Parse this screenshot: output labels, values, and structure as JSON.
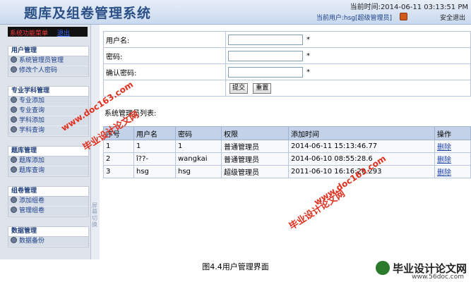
{
  "header": {
    "title": "题库及组卷管理系统",
    "time": "当前时间:2014-06-11 03:13:51 PM",
    "user": "当前用户:hsg[超级管理员]",
    "logout": "安全退出"
  },
  "sidebar": {
    "menu_label": "系统功能菜单",
    "menu_exit": "退出",
    "groups": [
      {
        "title": "用户管理",
        "items": [
          "系统管理员管理",
          "修改个人密码"
        ]
      },
      {
        "title": "专业学科管理",
        "items": [
          "专业添加",
          "专业查询",
          "学科添加",
          "学科查询"
        ]
      },
      {
        "title": "题库管理",
        "items": [
          "题库添加",
          "题库查询"
        ]
      },
      {
        "title": "组卷管理",
        "items": [
          "添加组卷",
          "管理组卷"
        ]
      },
      {
        "title": "数据管理",
        "items": [
          "数据备份"
        ]
      }
    ],
    "splitter": "屏幕切换"
  },
  "form": {
    "username_label": "用户名:",
    "password_label": "密码:",
    "confirm_label": "确认密码:",
    "required": "*",
    "submit": "提交",
    "reset": "重置"
  },
  "list": {
    "caption": "系统管理员列表:",
    "headers": [
      "序号",
      "用户名",
      "密码",
      "权限",
      "添加时间",
      "操作"
    ],
    "rows": [
      [
        "1",
        "1",
        "1",
        "普通管理员",
        "2014-06-11 15:13:46.77",
        "删除"
      ],
      [
        "2",
        "î??-",
        "wangkai",
        "普通管理员",
        "2014-06-10 08:55:28.6",
        "删除"
      ],
      [
        "3",
        "hsg",
        "hsg",
        "超级管理员",
        "2011-06-10 16:16:20.293",
        "删除"
      ]
    ]
  },
  "watermarks": [
    "www.doc163.com",
    "毕业设计论文网",
    "毕业设计论文网",
    "www.doc163.com"
  ],
  "caption": "图4.4用户管理界面",
  "brand": {
    "name": "毕业设计论文网",
    "url": "www.56doc.com"
  }
}
